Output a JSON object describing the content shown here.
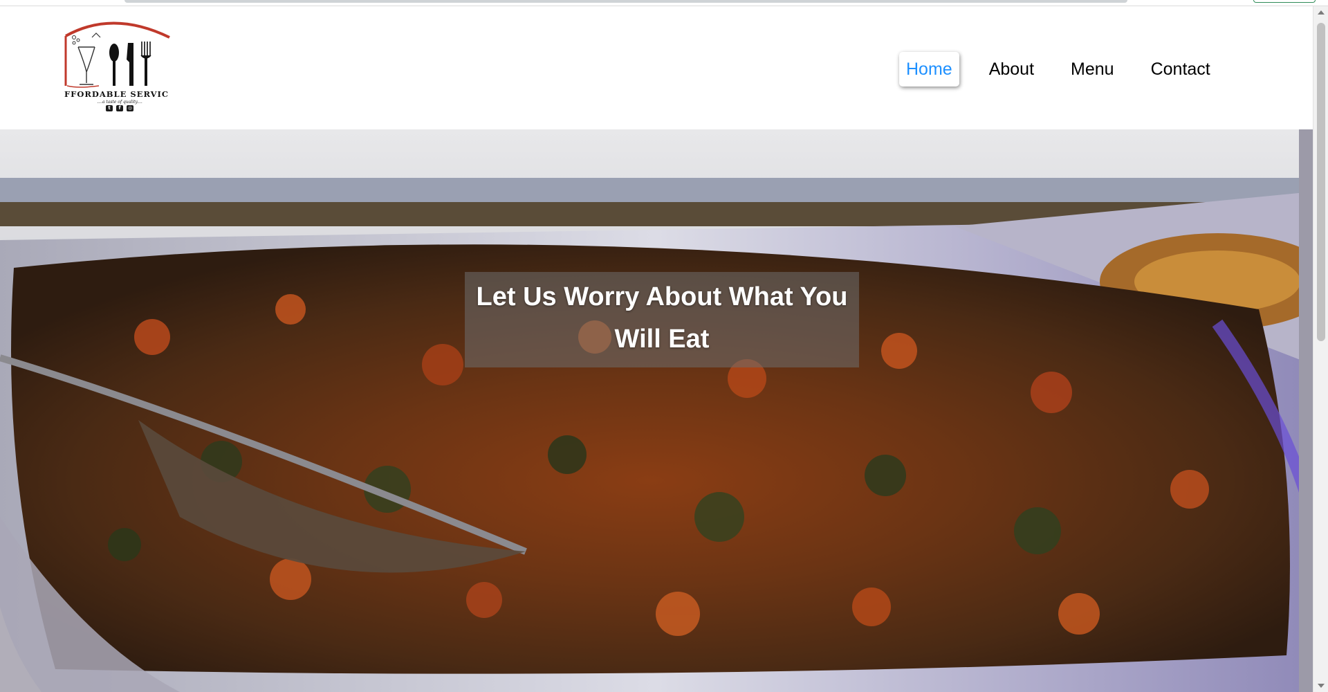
{
  "logo": {
    "name": "FFORDABLE SERVIC",
    "tagline": "....a taste of quality....",
    "social_icons": [
      "twitter-icon",
      "facebook-icon",
      "instagram-icon"
    ],
    "accent_color": "#c0392b"
  },
  "nav": {
    "items": [
      {
        "label": "Home",
        "active": true
      },
      {
        "label": "About",
        "active": false
      },
      {
        "label": "Menu",
        "active": false
      },
      {
        "label": "Contact",
        "active": false
      }
    ],
    "active_color": "#1e90ff"
  },
  "hero": {
    "caption": "Let Us Worry About What You Will Eat"
  }
}
